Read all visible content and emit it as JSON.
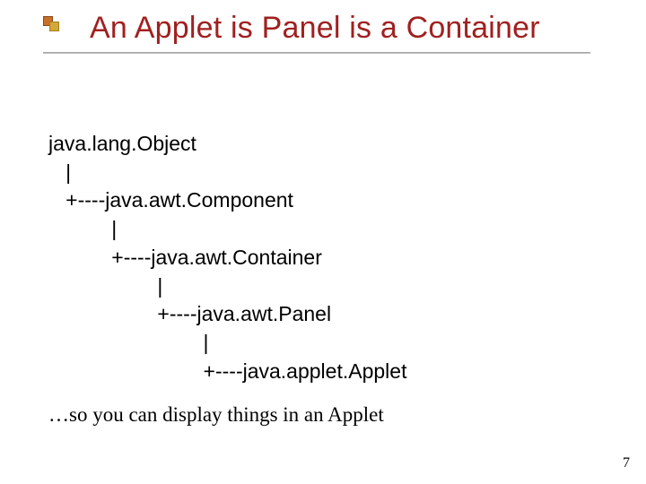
{
  "slide": {
    "title": "An Applet is Panel is a Container",
    "hierarchy": {
      "lines": [
        "java.lang.Object",
        "   |",
        "   +----java.awt.Component",
        "           |",
        "           +----java.awt.Container",
        "                   |",
        "                   +----java.awt.Panel",
        "                           |",
        "                           +----java.applet.Applet"
      ]
    },
    "footnote": "…so you can display things in an Applet",
    "page_number": "7"
  }
}
